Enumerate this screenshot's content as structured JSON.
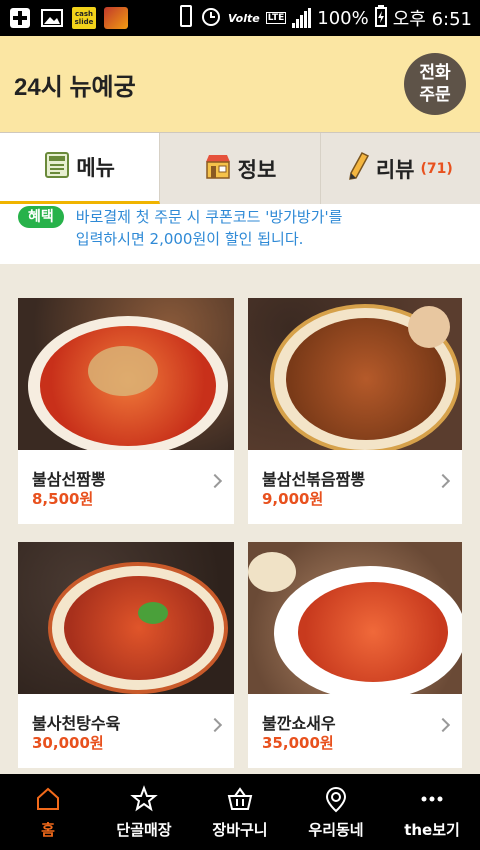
{
  "status_bar": {
    "cash_label": "cash slide",
    "network": "LTE",
    "volte": "Volte",
    "battery": "100%",
    "time": "오후 6:51"
  },
  "header": {
    "title": "24시 뉴예궁",
    "call_label_1": "전화",
    "call_label_2": "주문"
  },
  "tabs": [
    {
      "label": "메뉴",
      "icon": "menu-book-icon",
      "active": true
    },
    {
      "label": "정보",
      "icon": "store-icon"
    },
    {
      "label": "리뷰",
      "icon": "pencil-icon",
      "count": "(71)"
    }
  ],
  "notice": {
    "badge": "혜택",
    "line1": "바로결제 첫 주문 시 쿠폰코드 '방가방가'를",
    "line2": "입력하시면 2,000원이 할인 됩니다."
  },
  "menu_items": [
    {
      "name": "불삼선짬뽕",
      "price": "8,500원"
    },
    {
      "name": "불삼선볶음짬뽕",
      "price": "9,000원"
    },
    {
      "name": "불사천탕수육",
      "price": "30,000원"
    },
    {
      "name": "불깐쇼새우",
      "price": "35,000원"
    }
  ],
  "bottom_nav": [
    {
      "label": "홈",
      "icon": "home-icon",
      "active": true
    },
    {
      "label": "단골매장",
      "icon": "star-icon"
    },
    {
      "label": "장바구니",
      "icon": "basket-icon"
    },
    {
      "label": "우리동네",
      "icon": "location-icon"
    },
    {
      "label": "the보기",
      "icon": "more-icon"
    }
  ],
  "colors": {
    "header_bg": "#fbe6a3",
    "accent": "#e8511e",
    "notice_badge": "#27b24a",
    "notice_text": "#2f8ad6",
    "nav_active": "#f26a1b"
  }
}
